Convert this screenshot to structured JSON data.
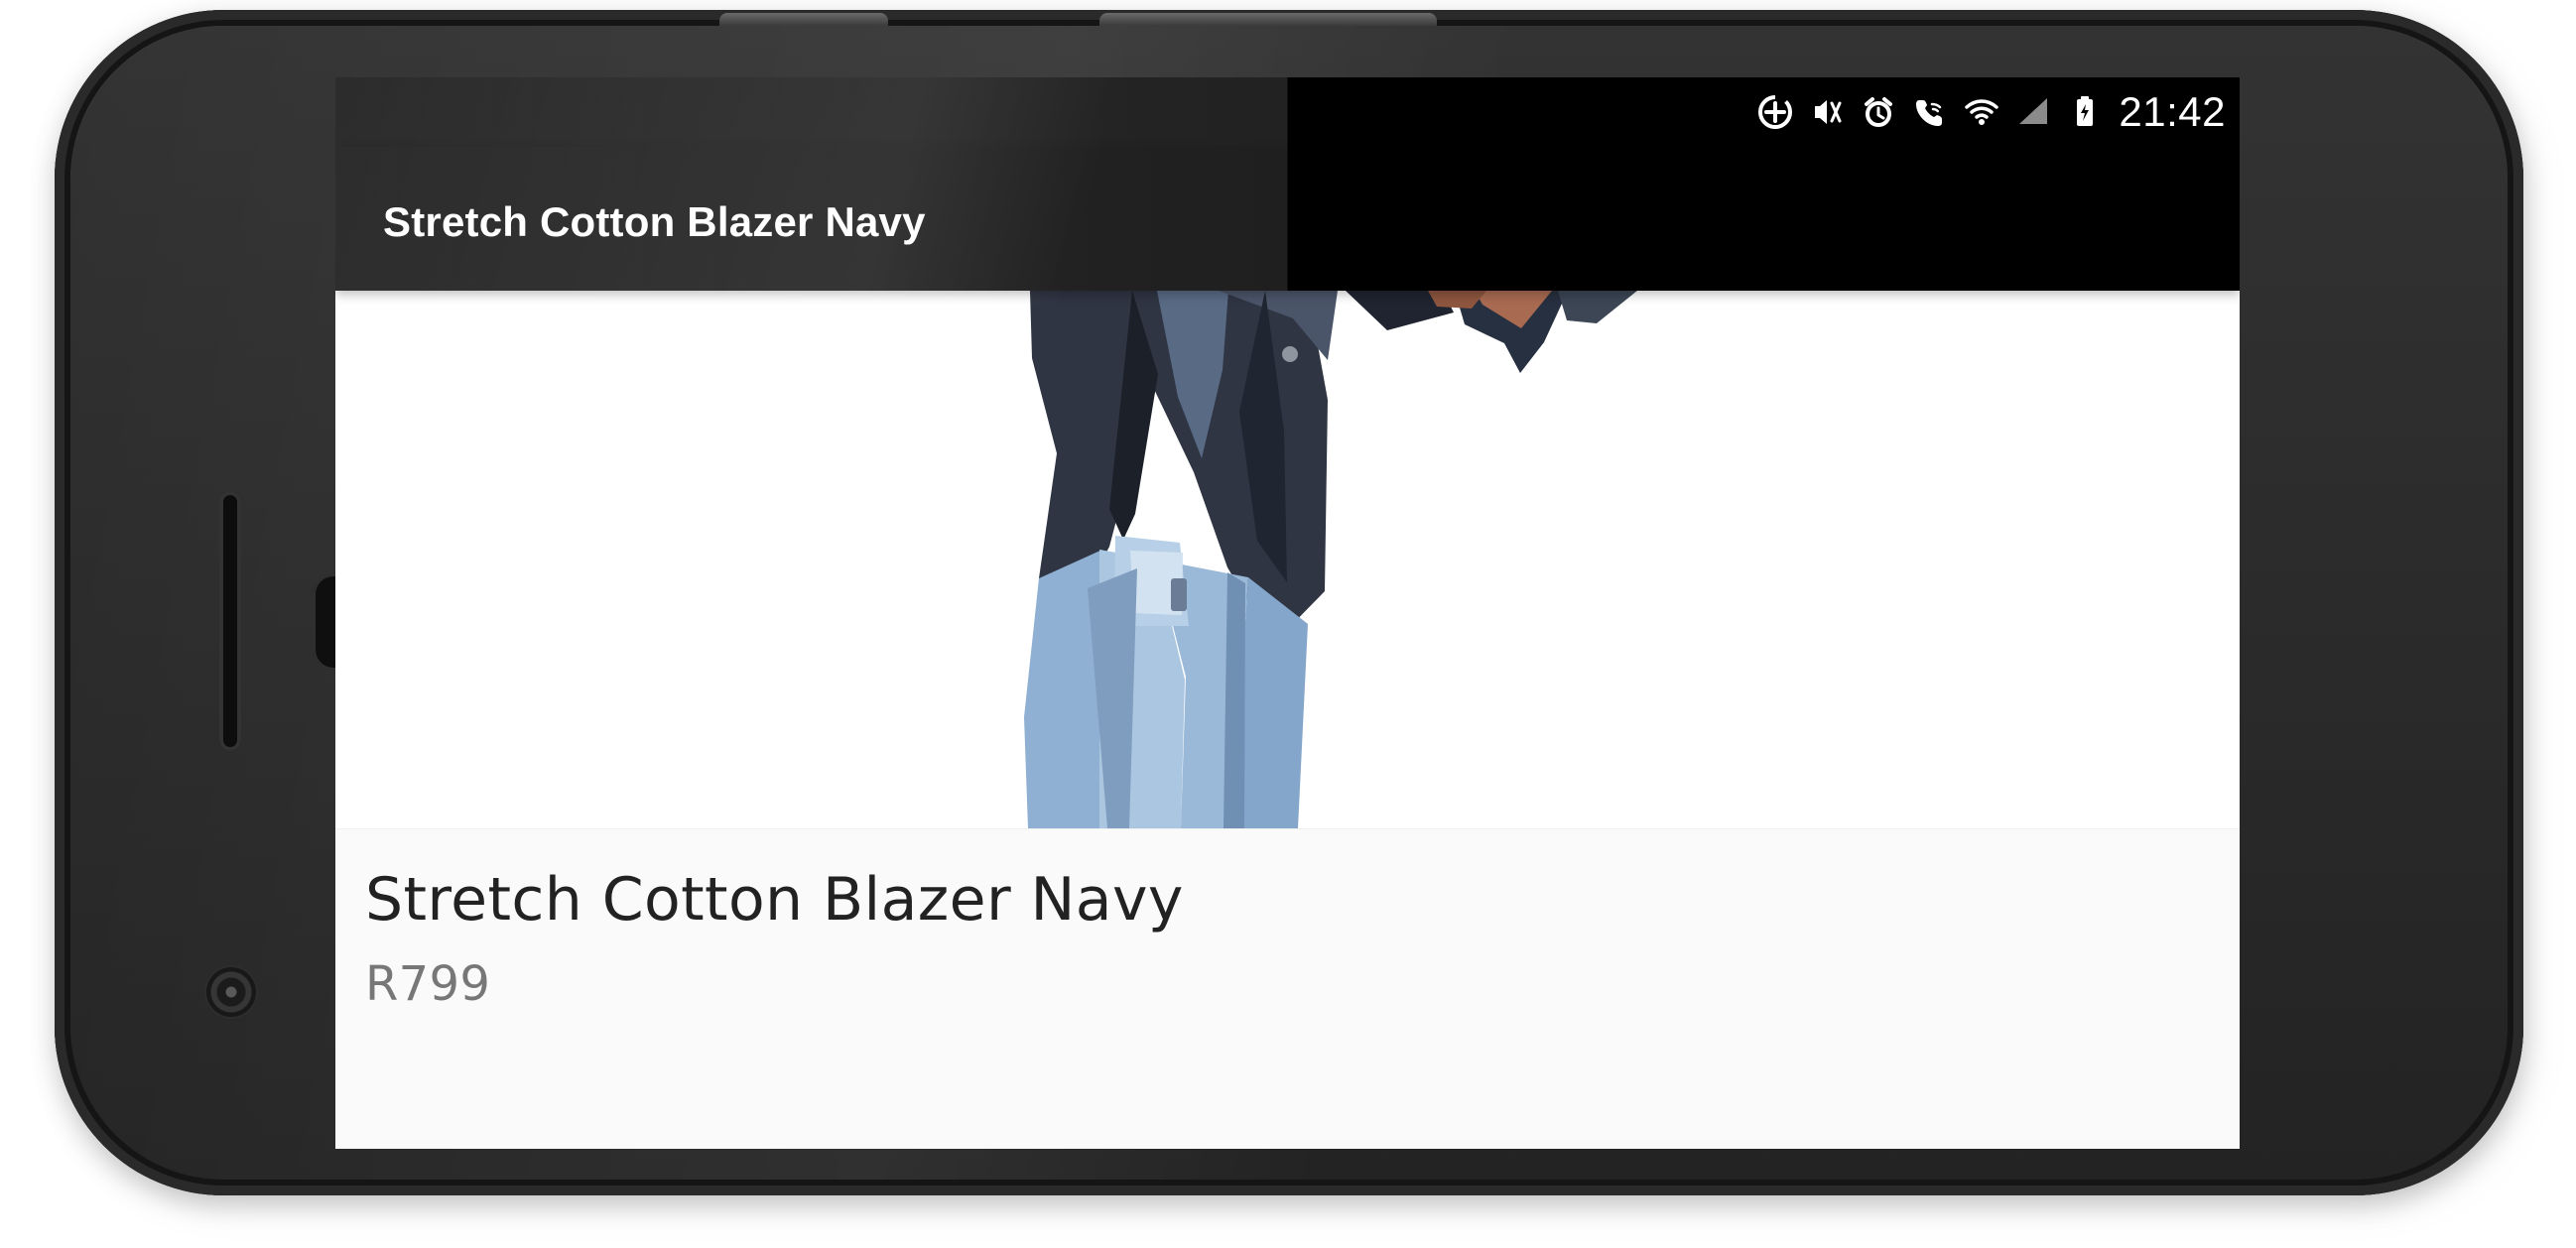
{
  "device": {
    "name": "android-phone-landscape"
  },
  "status_bar": {
    "time": "21:42",
    "icons": [
      "data-saver-icon",
      "vibrate-icon",
      "alarm-icon",
      "wifi-call-icon",
      "wifi-icon",
      "cell-signal-icon",
      "battery-charging-icon"
    ]
  },
  "app_bar": {
    "title": "Stretch Cotton Blazer Navy"
  },
  "product": {
    "name": "Stretch Cotton Blazer Navy",
    "price": "R799",
    "image_icon": "product-photo"
  },
  "colors": {
    "app_bar": "#000000",
    "screen_background": "#ffffff",
    "details_background": "#fafafa",
    "title_text": "#222222",
    "price_text": "#777777"
  }
}
